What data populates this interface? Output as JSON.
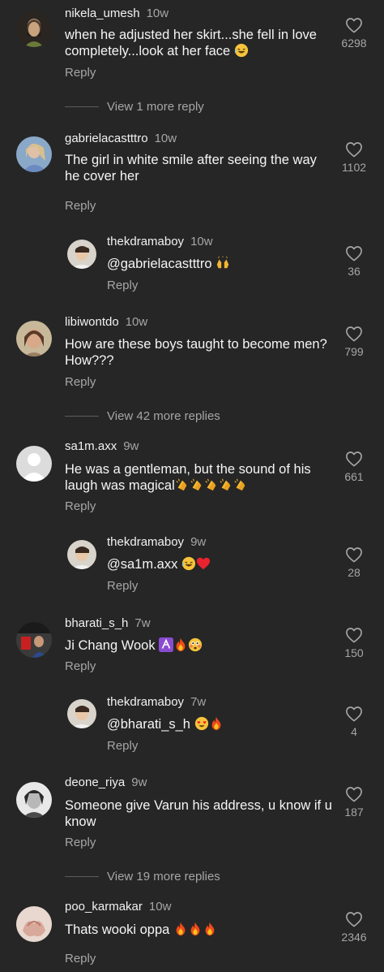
{
  "reply_label": "Reply",
  "comments": [
    {
      "user": "nikela_umesh",
      "time": "10w",
      "text": "when he adjusted her skirt...she fell in love completely...look at her face",
      "likes": "6298"
    },
    {
      "view_more": "View 1 more reply"
    },
    {
      "user": "gabrielacastttro",
      "time": "10w",
      "text": "The girl in white smile after seeing the way he cover her",
      "likes": "1102"
    },
    {
      "user": "thekdramaboy",
      "time": "10w",
      "text": "@gabrielacastttro",
      "likes": "36"
    },
    {
      "user": "libiwontdo",
      "time": "10w",
      "text": "How are these boys taught to become men? How???",
      "likes": "799"
    },
    {
      "view_more": "View 42 more replies"
    },
    {
      "user": "sa1m.axx",
      "time": "9w",
      "text": "He was a gentleman, but the sound of his laugh was magical",
      "likes": "661"
    },
    {
      "user": "thekdramaboy",
      "time": "9w",
      "text": "@sa1m.axx",
      "likes": "28"
    },
    {
      "user": "bharati_s_h",
      "time": "7w",
      "text": "Ji Chang Wook",
      "likes": "150"
    },
    {
      "user": "thekdramaboy",
      "time": "7w",
      "text": "@bharati_s_h",
      "likes": "4"
    },
    {
      "user": "deone_riya",
      "time": "9w",
      "text": "Someone give Varun his address, u know if u know",
      "likes": "187"
    },
    {
      "view_more": "View 19 more replies"
    },
    {
      "user": "poo_karmakar",
      "time": "10w",
      "text": "Thats wooki oppa",
      "likes": "2346"
    }
  ],
  "icons": {
    "heart": "heart-outline-icon",
    "laugh": "laughing-emoji",
    "clap": "clapping-emoji",
    "heart_red": "red-heart-emoji",
    "fire": "fire-emoji",
    "hands": "raised-hands-emoji",
    "heart_eyes": "heart-eyes-emoji",
    "flushed": "flushed-emoji",
    "zodiac": "zodiac-symbol-emoji"
  },
  "colors": {
    "background": "#262626",
    "muted": "#a6a6a6",
    "text": "#f5f5f5"
  }
}
